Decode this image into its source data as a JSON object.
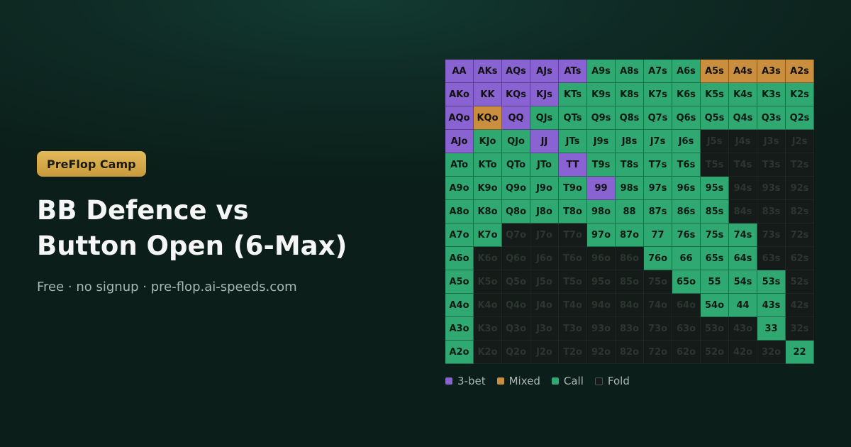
{
  "brand": {
    "badge": "PreFlop Camp"
  },
  "headline": {
    "line1": "BB Defence vs",
    "line2": "Button Open (6-Max)"
  },
  "subtitle": "Free · no signup · pre-flop.ai-speeds.com",
  "colors": {
    "3bet": "#8a63d2",
    "mixed": "#c98f3e",
    "call": "#2fa872",
    "fold": "#141b18",
    "badge": "#d9ad4c"
  },
  "legend": [
    {
      "key": "3bet",
      "label": "3-bet"
    },
    {
      "key": "mixed",
      "label": "Mixed"
    },
    {
      "key": "call",
      "label": "Call"
    },
    {
      "key": "fold",
      "label": "Fold"
    }
  ],
  "ranks": [
    "A",
    "K",
    "Q",
    "J",
    "T",
    "9",
    "8",
    "7",
    "6",
    "5",
    "4",
    "3",
    "2"
  ],
  "chart_data": {
    "type": "table",
    "actions": {
      "R": "3-bet",
      "M": "Mixed",
      "C": "Call",
      "F": "Fold"
    },
    "rows": [
      "RRRRRCCCCMMMM",
      "RRRRCCCCCCCCC",
      "RMRCCCCCCCCCC",
      "RCCRCCCCCFFFF",
      "CCCCRCCCCFFFF",
      "CCCCCRCCCCFFF",
      "CCCCCCCCCCFFF",
      "CCFFFCCCCCCFF",
      "CFFFFFFCCCCFF",
      "CFFFFFFFCCCCF",
      "CFFFFFFFFCCCF",
      "CFFFFFFFFFFCF",
      "CFFFFFFFFFFFC"
    ]
  }
}
